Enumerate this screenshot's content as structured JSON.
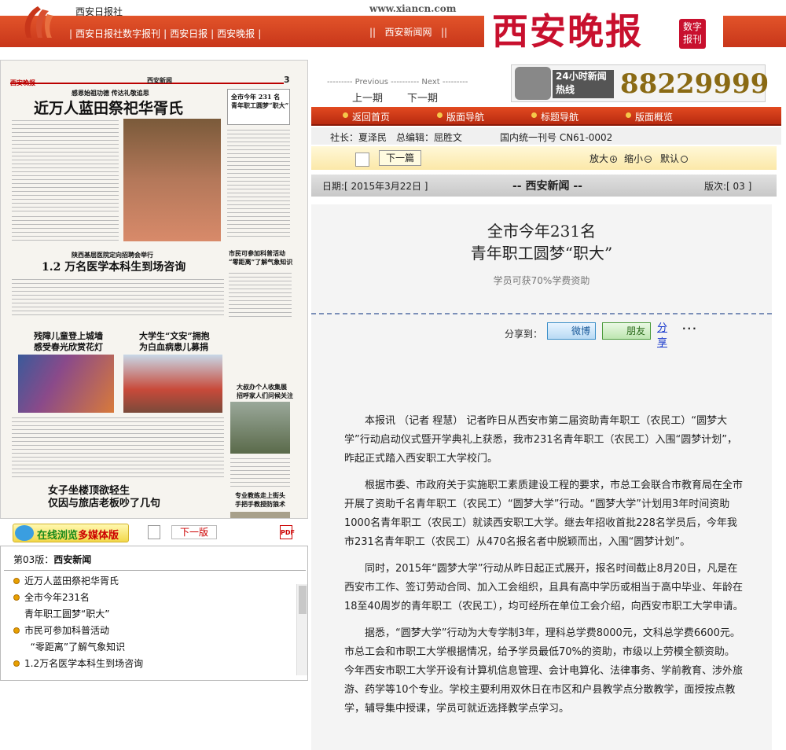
{
  "header": {
    "paper_name": "西安日报社",
    "site": "www.xiancn.com",
    "nav": [
      "西安日报社数字报刊",
      "西安日报",
      "西安晚报"
    ],
    "nav2": "西安新闻网",
    "brand": "西安晚报",
    "brand_tag": "数字报刊"
  },
  "hotline": {
    "label": "24小时新闻热线",
    "number": "88229999"
  },
  "prevnext": {
    "prev_small": "Previous",
    "next_small": "Next",
    "prev": "上一期",
    "next": "下一期"
  },
  "menu": [
    "返回首页",
    "版面导航",
    "标题导航",
    "版面概览"
  ],
  "meta": {
    "president": "社长：夏泽民",
    "editor": "总编辑：屈胜文",
    "issn": "国内统一刊号 CN61-0002"
  },
  "zoom": {
    "next_btn": "下一篇",
    "zoom_in": "放大",
    "zoom_out": "缩小",
    "default": "默认"
  },
  "info": {
    "date": "日期:[ 2015年3月22日 ]",
    "section": "-- 西安新闻 --",
    "page": "版次:[ 03 ]"
  },
  "article": {
    "title1": "全市今年231名",
    "title2": "青年职工圆梦“职大”",
    "subtitle": "学员可获70%学费资助",
    "share_label": "分享到：",
    "weibo": "微博",
    "friends": "朋友",
    "share": "分享",
    "more": "...",
    "paragraphs": [
      "本报讯 （记者 程慧） 记者昨日从西安市第二届资助青年职工（农民工）“圆梦大学”行动启动仪式暨开学典礼上获悉，我市231名青年职工（农民工）入围“圆梦计划”，昨起正式踏入西安职工大学校门。",
      "根据市委、市政府关于实施职工素质建设工程的要求，市总工会联合市教育局在全市开展了资助千名青年职工（农民工）“圆梦大学”行动。“圆梦大学”计划用3年时间资助1000名青年职工（农民工）就读西安职工大学。继去年招收首批228名学员后，今年我市231名青年职工（农民工）从470名报名者中脱颖而出，入围“圆梦计划”。",
      "同时，2015年“圆梦大学”行动从昨日起正式展开，报名时间截止8月20日，凡是在西安市工作、签订劳动合同、加入工会组织，且具有高中学历或相当于高中毕业、年龄在18至40周岁的青年职工（农民工），均可经所在单位工会介绍，向西安市职工大学申请。",
      "据悉，“圆梦大学”行动为大专学制3年，理科总学费8000元，文科总学费6600元。市总工会和市职工大学根据情况，给予学员最低70%的资助，市级以上劳模全额资助。今年西安市职工大学开设有计算机信息管理、会计电算化、法律事务、学前教育、涉外旅游、药学等10个专业。学校主要利用双休日在市区和户县教学点分散教学，面授按点教学，辅导集中授课，学员可就近选择教学点学习。"
    ]
  },
  "paper": {
    "masthead": "西安晚报",
    "section": "西安新闻",
    "page_no": "3",
    "kicker1": "感恩始祖功德  传达礼敬追思",
    "h1": "近万人蓝田祭祀华胥氏",
    "sub1": "全市今年 231 名\n青年职工圆梦“职大”",
    "kicker2": "陕西基层医院定向招聘会举行",
    "h2": "1.2 万名医学本科生到场咨询",
    "side1": "市民可参加科普活动\n“零距离”了解气象知识",
    "h3": "残障儿童登上城墙\n感受春光欣赏花灯",
    "h4": "大学生“文安”拥抱\n为白血病患儿募捐",
    "side2": "大叔办个人收集展\n招呼家人们问候关注",
    "h5": "女子坐楼顶欲轻生\n仅因与旅店老板吵了几句",
    "side3": "专业教练走上街头\n手把手教授防狼术"
  },
  "media": {
    "label_a": "在线浏览",
    "label_b": "多媒体版",
    "next": "下一版",
    "pdf": "PDF"
  },
  "toc": {
    "title_prefix": "第03版：",
    "title_section": "西安新闻",
    "items": [
      [
        "近万人蓝田祭祀华胥氏"
      ],
      [
        "全市今年231名",
        "青年职工圆梦“职大”"
      ],
      [
        "市民可参加科普活动",
        "“零距离”了解气象知识"
      ],
      [
        "1.2万名医学本科生到场咨询"
      ]
    ]
  },
  "colors": {
    "brand_red": "#c8361a",
    "accent_gold": "#8a6a14",
    "link_blue": "#1a3acc"
  }
}
